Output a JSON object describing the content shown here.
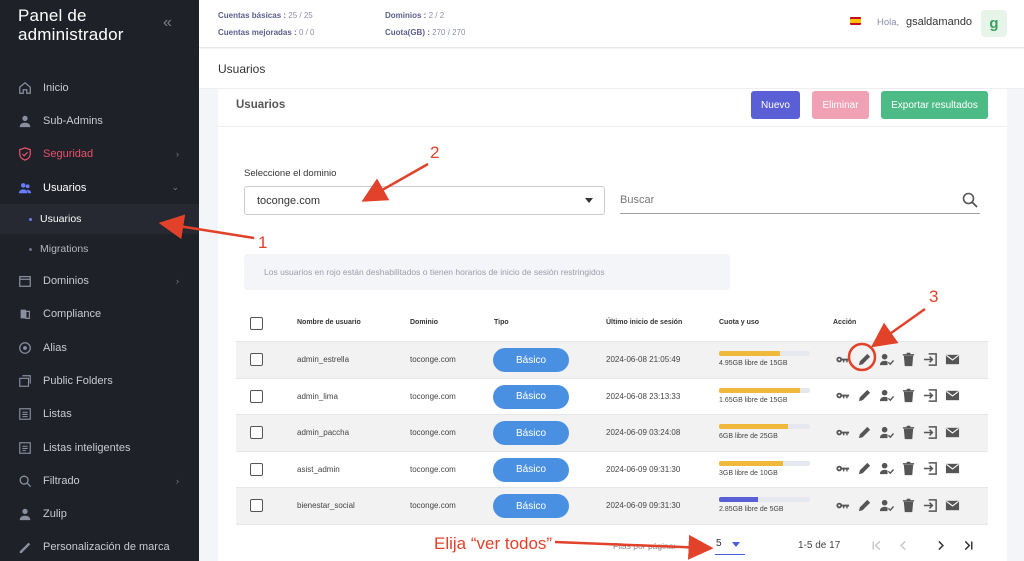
{
  "sidebar": {
    "brand_line1": "Panel de",
    "brand_line2": "administrador",
    "collapse_glyph": "«",
    "items": [
      {
        "label": "Inicio",
        "icon": "home-icon"
      },
      {
        "label": "Sub-Admins",
        "icon": "person-icon"
      },
      {
        "label": "Seguridad",
        "icon": "shield-icon"
      },
      {
        "label": "Usuarios",
        "icon": "users-icon"
      },
      {
        "label": "Dominios",
        "icon": "calendar-icon"
      },
      {
        "label": "Compliance",
        "icon": "compliance-icon"
      },
      {
        "label": "Alias",
        "icon": "alias-icon"
      },
      {
        "label": "Public Folders",
        "icon": "folders-icon"
      },
      {
        "label": "Listas",
        "icon": "list-icon"
      },
      {
        "label": "Listas inteligentes",
        "icon": "smart-list-icon"
      },
      {
        "label": "Filtrado",
        "icon": "search-icon"
      },
      {
        "label": "Zulip",
        "icon": "zulip-icon"
      },
      {
        "label": "Personalización de marca",
        "icon": "brand-icon"
      }
    ],
    "sub_items": [
      "Usuarios",
      "Migrations"
    ],
    "accent_color": "#e8516a"
  },
  "header": {
    "stats": [
      {
        "label": "Cuentas básicas :",
        "value": "25 / 25"
      },
      {
        "label": "Cuentas mejoradas :",
        "value": "0 / 0"
      },
      {
        "label": "Dominios :",
        "value": "2 / 2"
      },
      {
        "label": "Cuota(GB) :",
        "value": "270 / 270"
      }
    ],
    "hello": "Hola,",
    "user": "gsaldamando",
    "avatar_letter": "g"
  },
  "page_title": "Usuarios",
  "card": {
    "title": "Usuarios",
    "buttons": {
      "new": "Nuevo",
      "delete": "Eliminar",
      "export": "Exportar resultados"
    },
    "domain_label": "Seleccione el dominio",
    "domain_value": "toconge.com",
    "search_placeholder": "Buscar",
    "notice": "Los usuarios en rojo están deshabilitados o tienen horarios de inicio de sesión restringidos"
  },
  "table": {
    "headers": [
      "Nombre de usuario",
      "Dominio",
      "Tipo",
      "Último inicio de sesión",
      "Cuota y uso",
      "Acción"
    ],
    "rows": [
      {
        "user": "admin_estrella",
        "domain": "toconge.com",
        "type": "Básico",
        "last_login": "2024-06-08 21:05:49",
        "quota_text": "4.95GB libre de 15GB",
        "usage": 0.67,
        "bar_color": "#f0b93b"
      },
      {
        "user": "admin_lima",
        "domain": "toconge.com",
        "type": "Básico",
        "last_login": "2024-06-08 23:13:33",
        "quota_text": "1.65GB libre de 15GB",
        "usage": 0.89,
        "bar_color": "#f0b93b"
      },
      {
        "user": "admin_paccha",
        "domain": "toconge.com",
        "type": "Básico",
        "last_login": "2024-06-09 03:24:08",
        "quota_text": "6GB libre de 25GB",
        "usage": 0.76,
        "bar_color": "#f0b93b"
      },
      {
        "user": "asist_admin",
        "domain": "toconge.com",
        "type": "Básico",
        "last_login": "2024-06-09 09:31:30",
        "quota_text": "3GB libre de 10GB",
        "usage": 0.7,
        "bar_color": "#f0b93b"
      },
      {
        "user": "bienestar_social",
        "domain": "toconge.com",
        "type": "Básico",
        "last_login": "2024-06-09 09:31:30",
        "quota_text": "2.85GB libre de 5GB",
        "usage": 0.43,
        "bar_color": "#5b5fd6"
      }
    ],
    "action_icons": [
      "key-icon",
      "edit-pencil-icon",
      "user-check-icon",
      "trash-icon",
      "login-arrow-icon",
      "mail-icon"
    ]
  },
  "pagination": {
    "rows_label": "Filas por página:",
    "rows_value": "5",
    "range": "1-5 de 17"
  },
  "annotations": {
    "n1": "1",
    "n2": "2",
    "n3": "3",
    "hint": "Elija “ver todos”",
    "color": "#e2412a"
  }
}
